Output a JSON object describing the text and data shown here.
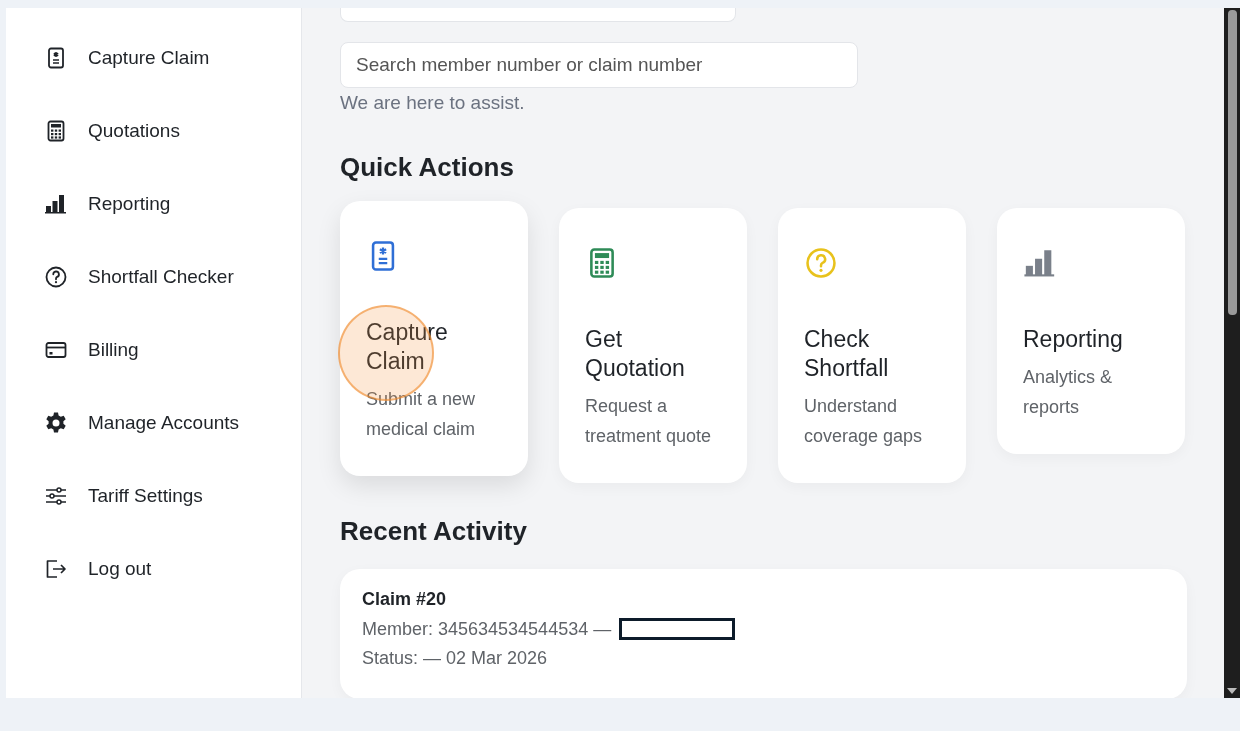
{
  "sidebar": {
    "items": [
      {
        "label": "Capture Claim",
        "kind": "claim"
      },
      {
        "label": "Quotations",
        "kind": "calculator"
      },
      {
        "label": "Reporting",
        "kind": "chart"
      },
      {
        "label": "Shortfall Checker",
        "kind": "question"
      },
      {
        "label": "Billing",
        "kind": "card"
      },
      {
        "label": "Manage Accounts",
        "kind": "gear"
      },
      {
        "label": "Tariff Settings",
        "kind": "sliders"
      },
      {
        "label": "Log out",
        "kind": "logout"
      }
    ]
  },
  "search": {
    "placeholder": "Search member number or claim number"
  },
  "assist_text": "We are here to assist.",
  "quick_actions": {
    "title": "Quick Actions",
    "cards": [
      {
        "title": "Capture Claim",
        "description": "Submit a new medical claim",
        "kind": "claim",
        "color": "#2f6fd6",
        "hovered": true
      },
      {
        "title": "Get Quotation",
        "description": "Request a treatment quote",
        "kind": "calculator",
        "color": "#2e8b57",
        "hovered": false
      },
      {
        "title": "Check Shortfall",
        "description": "Understand coverage gaps",
        "kind": "question",
        "color": "#e8c21c",
        "hovered": false
      },
      {
        "title": "Reporting",
        "description": "Analytics & reports",
        "kind": "chart",
        "color": "#7a808a",
        "hovered": false
      }
    ]
  },
  "recent_activity": {
    "title": "Recent Activity",
    "items": [
      {
        "title": "Claim #20",
        "member": "Member: 345634534544534 —",
        "status": "Status: — 02 Mar 2026"
      }
    ]
  }
}
